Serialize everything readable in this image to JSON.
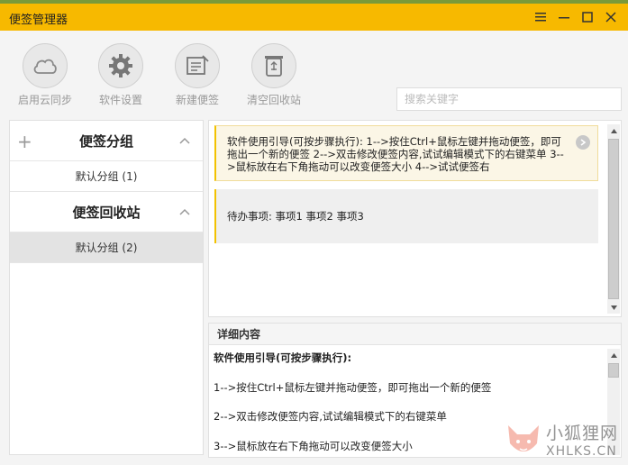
{
  "window": {
    "title": "便签管理器",
    "accent": "#f7b900"
  },
  "toolbar": {
    "buttons": [
      {
        "label": "启用云同步",
        "icon": "cloud-icon"
      },
      {
        "label": "软件设置",
        "icon": "gear-icon"
      },
      {
        "label": "新建便签",
        "icon": "new-note-icon"
      },
      {
        "label": "清空回收站",
        "icon": "recycle-bin-icon"
      }
    ],
    "search_placeholder": "搜索关键字"
  },
  "sidebar": {
    "groups": [
      {
        "title": "便签分组",
        "items": [
          "默认分组 (1)"
        ]
      },
      {
        "title": "便签回收站",
        "items": [
          "默认分组 (2)"
        ]
      }
    ]
  },
  "notes": [
    {
      "text": "软件使用引导(可按步骤执行): 1-->按住Ctrl+鼠标左键并拖动便签，即可拖出一个新的便签 2-->双击修改便签内容,试试编辑模式下的右键菜单 3-->鼠标放在右下角拖动可以改变便签大小 4-->试试便签右"
    },
    {
      "text": "待办事项: 事项1 事项2 事项3"
    }
  ],
  "detail": {
    "header": "详细内容",
    "lines": [
      "软件使用引导(可按步骤执行):",
      "1-->按住Ctrl+鼠标左键并拖动便签，即可拖出一个新的便签",
      "2-->双击修改便签内容,试试编辑模式下的右键菜单",
      "3-->鼠标放在右下角拖动可以改变便签大小"
    ]
  },
  "watermark": {
    "line1": "小狐狸网",
    "line2": "XHLKS.CN"
  }
}
